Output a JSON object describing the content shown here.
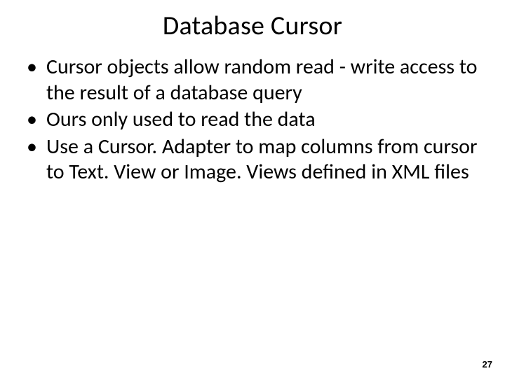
{
  "slide": {
    "title": "Database Cursor",
    "bullets": [
      "Cursor objects allow random read - write access to the result of a database query",
      "Ours only used to read the data",
      "Use a Cursor. Adapter to map columns from cursor to Text. View or Image. Views defined in XML files"
    ],
    "page_number": "27"
  }
}
